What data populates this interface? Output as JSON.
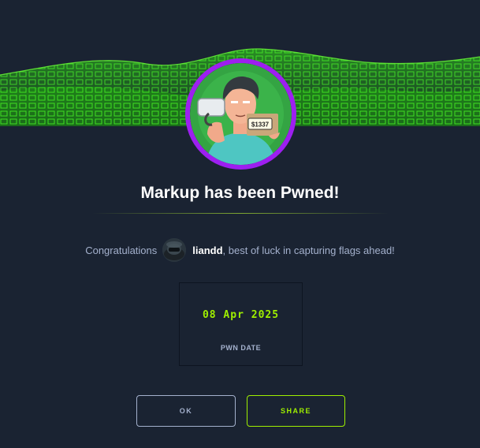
{
  "modal": {
    "title": "Markup has been Pwned!",
    "congrats_prefix": "Congratulations",
    "username": "liandd",
    "congrats_suffix": ", best of luck in capturing flags ahead!",
    "pwn_date_value": "08 Apr 2025",
    "pwn_date_label": "PWN DATE",
    "ok_label": "OK",
    "share_label": "SHARE",
    "avatar_badge_text": "$1337"
  },
  "colors": {
    "background": "#1a2332",
    "accent_green": "#9fef00",
    "ring_purple": "#9d1ff0",
    "muted_text": "#a4b1cd"
  },
  "icons": {
    "banner": "green-wave-banner",
    "machine_avatar": "hacker-avatar-icon",
    "user_avatar": "user-avatar-icon"
  }
}
